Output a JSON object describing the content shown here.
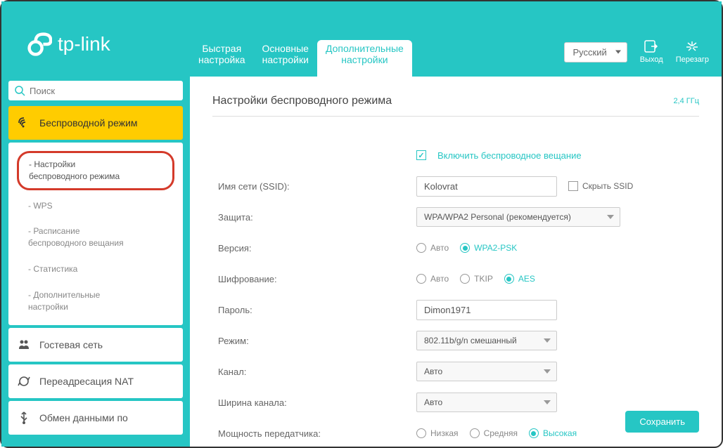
{
  "brand": "tp-link",
  "header": {
    "tabs": [
      {
        "line1": "Быстрая",
        "line2": "настройка"
      },
      {
        "line1": "Основные",
        "line2": "настройки"
      },
      {
        "line1": "Дополнительные",
        "line2": "настройки"
      }
    ],
    "language": "Русский",
    "logout": "Выход",
    "reboot": "Перезагр"
  },
  "sidebar": {
    "search_placeholder": "Поиск",
    "wireless": "Беспроводной режим",
    "sub": {
      "settings_l1": "- Настройки",
      "settings_l2": "беспроводного режима",
      "wps": "- WPS",
      "schedule_l1": "- Расписание",
      "schedule_l2": "беспроводного вещания",
      "stats": "- Статистика",
      "advanced_l1": "- Дополнительные",
      "advanced_l2": "настройки"
    },
    "guest": "Гостевая сеть",
    "nat": "Переадресация NAT",
    "data": "Обмен данными по"
  },
  "page": {
    "title": "Настройки беспроводного режима",
    "band": "2,4 ГГц"
  },
  "form": {
    "enable_wireless": "Включить беспроводное вещание",
    "ssid_label": "Имя сети (SSID):",
    "ssid_value": "Kolovrat",
    "hide_ssid": "Скрыть SSID",
    "security_label": "Защита:",
    "security_value": "WPA/WPA2 Personal (рекомендуется)",
    "version_label": "Версия:",
    "version_opts": [
      "Авто",
      "WPA2-PSK"
    ],
    "encryption_label": "Шифрование:",
    "encryption_opts": [
      "Авто",
      "TKIP",
      "AES"
    ],
    "password_label": "Пароль:",
    "password_value": "Dimon1971",
    "mode_label": "Режим:",
    "mode_value": "802.11b/g/n смешанный",
    "channel_label": "Канал:",
    "channel_value": "Авто",
    "width_label": "Ширина канала:",
    "width_value": "Авто",
    "power_label": "Мощность передатчика:",
    "power_opts": [
      "Низкая",
      "Средняя",
      "Высокая"
    ],
    "save": "Сохранить"
  }
}
